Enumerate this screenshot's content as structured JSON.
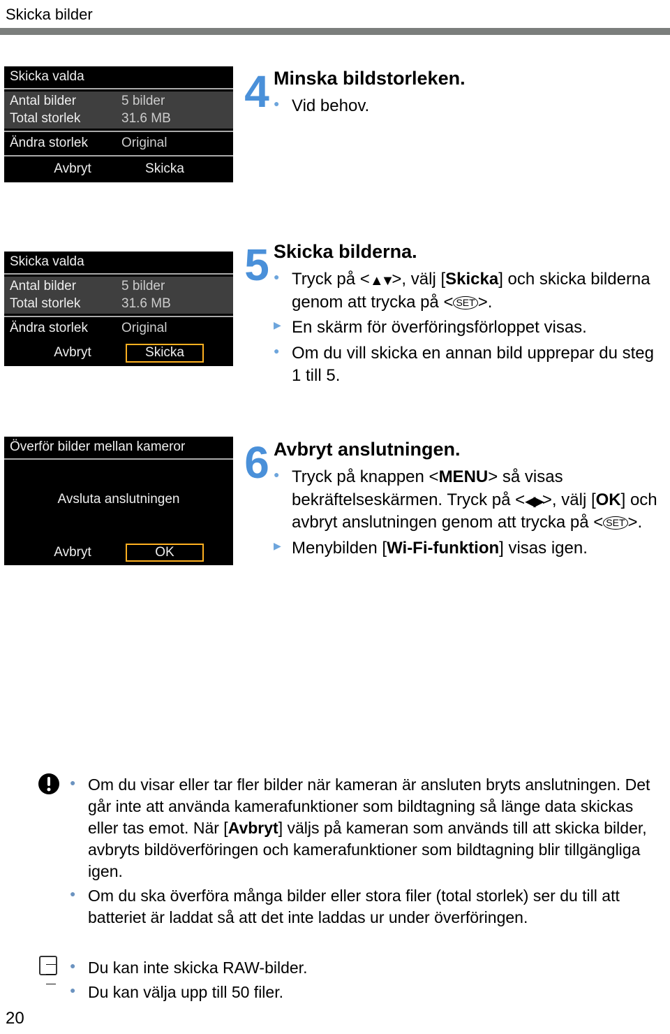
{
  "header": {
    "title": "Skicka bilder"
  },
  "page_number": "20",
  "cam1": {
    "title": "Skicka valda",
    "count_label": "Antal bilder",
    "count_value": "5 bilder",
    "size_label": "Total storlek",
    "size_value": "31.6 MB",
    "resize_label": "Ändra storlek",
    "resize_value": "Original",
    "btn_cancel": "Avbryt",
    "btn_send": "Skicka"
  },
  "cam2": {
    "title": "Skicka valda",
    "count_label": "Antal bilder",
    "count_value": "5 bilder",
    "size_label": "Total storlek",
    "size_value": "31.6 MB",
    "resize_label": "Ändra storlek",
    "resize_value": "Original",
    "btn_cancel": "Avbryt",
    "btn_send": "Skicka"
  },
  "cam3": {
    "title": "Överför bilder mellan kameror",
    "end_label": "Avsluta anslutningen",
    "btn_cancel": "Avbryt",
    "btn_ok": "OK"
  },
  "steps": {
    "s4": {
      "num": "4",
      "title": "Minska bildstorleken.",
      "b1": "Vid behov."
    },
    "s5": {
      "num": "5",
      "title": "Skicka bilderna.",
      "b1a": "Tryck på <",
      "b1b": ">, välj [",
      "b1c": "Skicka",
      "b1d": "] och skicka bilderna genom att trycka på <",
      "b1e": ">.",
      "b2": "En skärm för överföringsförloppet visas.",
      "b3": "Om du vill skicka en annan bild upprepar du steg 1 till 5."
    },
    "s6": {
      "num": "6",
      "title": "Avbryt anslutningen.",
      "b1a": "Tryck på knappen <",
      "b1b": "MENU",
      "b1c": "> så visas bekräftelseskärmen. Tryck på <",
      "b1d": ">, välj [",
      "b1e": "OK",
      "b1f": "] och avbryt anslutningen genom att trycka på <",
      "b1g": ">.",
      "b2a": "Menybilden [",
      "b2b": "Wi-Fi-funktion",
      "b2c": "] visas igen."
    }
  },
  "warn": {
    "b1a": "Om du visar eller tar fler bilder när kameran är ansluten bryts anslutningen. Det går inte att använda kamerafunktioner som bildtagning så länge data skickas eller tas emot. När [",
    "b1b": "Avbryt",
    "b1c": "] väljs på kameran som används till att skicka bilder, avbryts bildöverföringen och kamerafunktioner som bildtagning blir tillgängliga igen.",
    "b2": "Om du ska överföra många bilder eller stora filer (total storlek) ser du till att batteriet är laddat så att det inte laddas ur under överföringen."
  },
  "note": {
    "b1": "Du kan inte skicka RAW-bilder.",
    "b2": "Du kan välja upp till 50 filer."
  }
}
